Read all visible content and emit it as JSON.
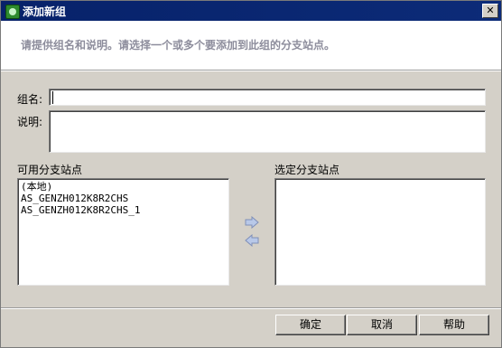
{
  "window": {
    "title": "添加新组",
    "close_label": "✕"
  },
  "header": {
    "instruction": "请提供组名和说明。请选择一个或多个要添加到此组的分支站点。"
  },
  "form": {
    "name_label": "组名:",
    "name_value": "",
    "desc_label": "说明:",
    "desc_value": ""
  },
  "lists": {
    "available_label": "可用分支站点",
    "available_items": [
      "(本地)",
      "AS_GENZH012K8R2CHS",
      "AS_GENZH012K8R2CHS_1"
    ],
    "selected_label": "选定分支站点",
    "selected_items": []
  },
  "buttons": {
    "ok": "确定",
    "cancel": "取消",
    "help": "帮助"
  },
  "colors": {
    "titlebar": "#0a246a",
    "dialog": "#d4d0c8",
    "header_text": "#8d8d9c"
  }
}
